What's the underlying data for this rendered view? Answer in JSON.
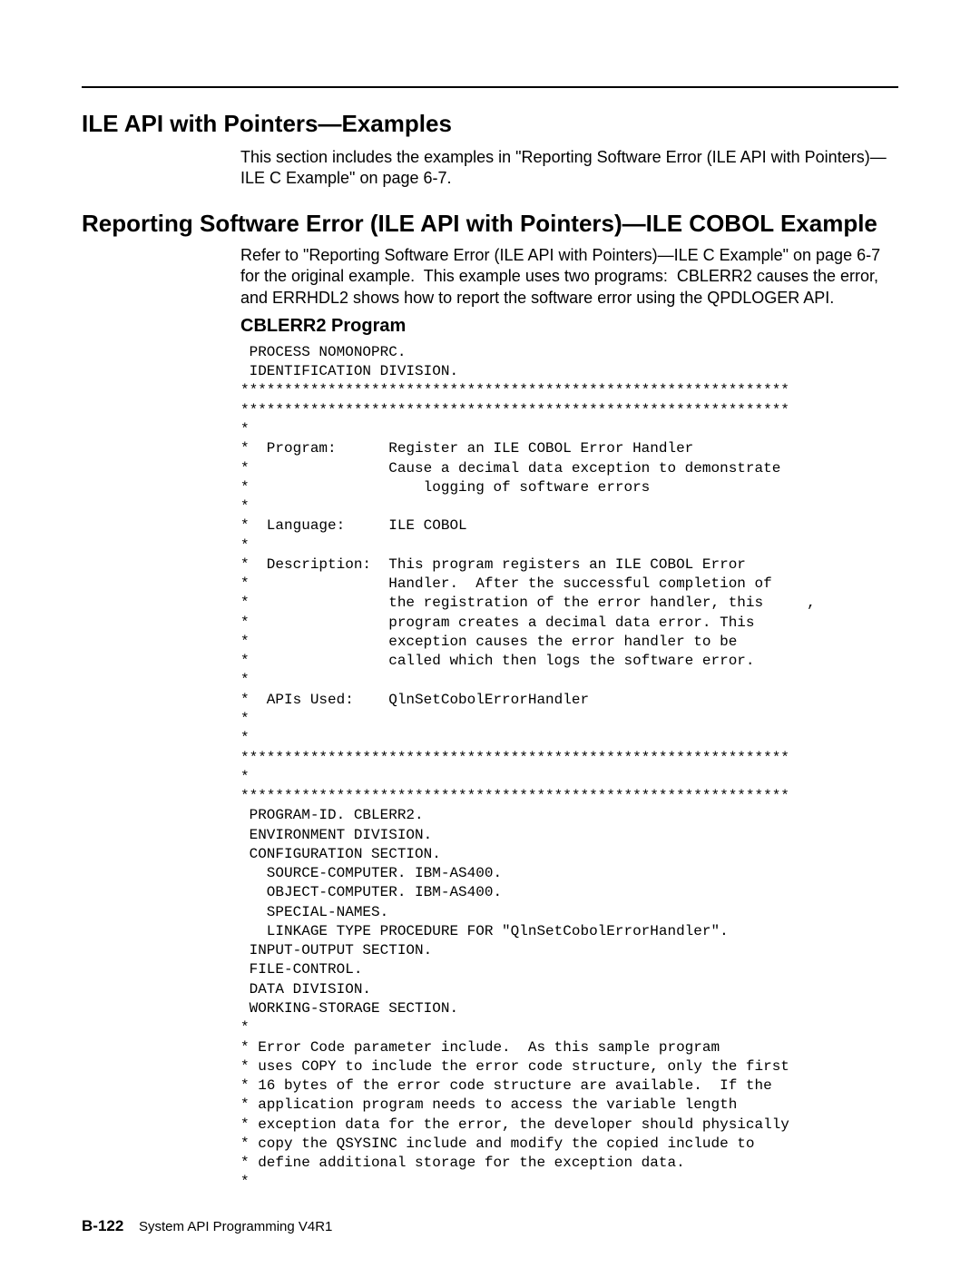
{
  "h1": "ILE API with Pointers—Examples",
  "p1": "This section includes the examples in \"Reporting Software Error (ILE API with Pointers)—ILE C Example\" on page 6-7.",
  "h2": "Reporting Software Error (ILE API with Pointers)—ILE COBOL Example",
  "p2": "Refer to \"Reporting Software Error (ILE API with Pointers)—ILE C Example\" on page 6-7 for the original example.  This example uses two programs:  CBLERR2 causes the error, and ERRHDL2 shows how to report the software error using the QPDLOGER API.",
  "h3": "CBLERR2 Program",
  "code": " PROCESS NOMONOPRC.\n IDENTIFICATION DIVISION.\n***************************************************************\n***************************************************************\n*\n*  Program:      Register an ILE COBOL Error Handler\n*                Cause a decimal data exception to demonstrate\n*                    logging of software errors\n*\n*  Language:     ILE COBOL\n*\n*  Description:  This program registers an ILE COBOL Error\n*                Handler.  After the successful completion of\n*                the registration of the error handler, this     ,\n*                program creates a decimal data error. This\n*                exception causes the error handler to be\n*                called which then logs the software error.\n*\n*  APIs Used:    QlnSetCobolErrorHandler\n*\n*\n***************************************************************\n*\n***************************************************************\n PROGRAM-ID. CBLERR2.\n ENVIRONMENT DIVISION.\n CONFIGURATION SECTION.\n   SOURCE-COMPUTER. IBM-AS400.\n   OBJECT-COMPUTER. IBM-AS400.\n   SPECIAL-NAMES.\n   LINKAGE TYPE PROCEDURE FOR \"QlnSetCobolErrorHandler\".\n INPUT-OUTPUT SECTION.\n FILE-CONTROL.\n DATA DIVISION.\n WORKING-STORAGE SECTION.\n*\n* Error Code parameter include.  As this sample program\n* uses COPY to include the error code structure, only the first\n* 16 bytes of the error code structure are available.  If the\n* application program needs to access the variable length\n* exception data for the error, the developer should physically\n* copy the QSYSINC include and modify the copied include to\n* define additional storage for the exception data.\n*",
  "footer_page": "B-122",
  "footer_text": "System API Programming V4R1"
}
